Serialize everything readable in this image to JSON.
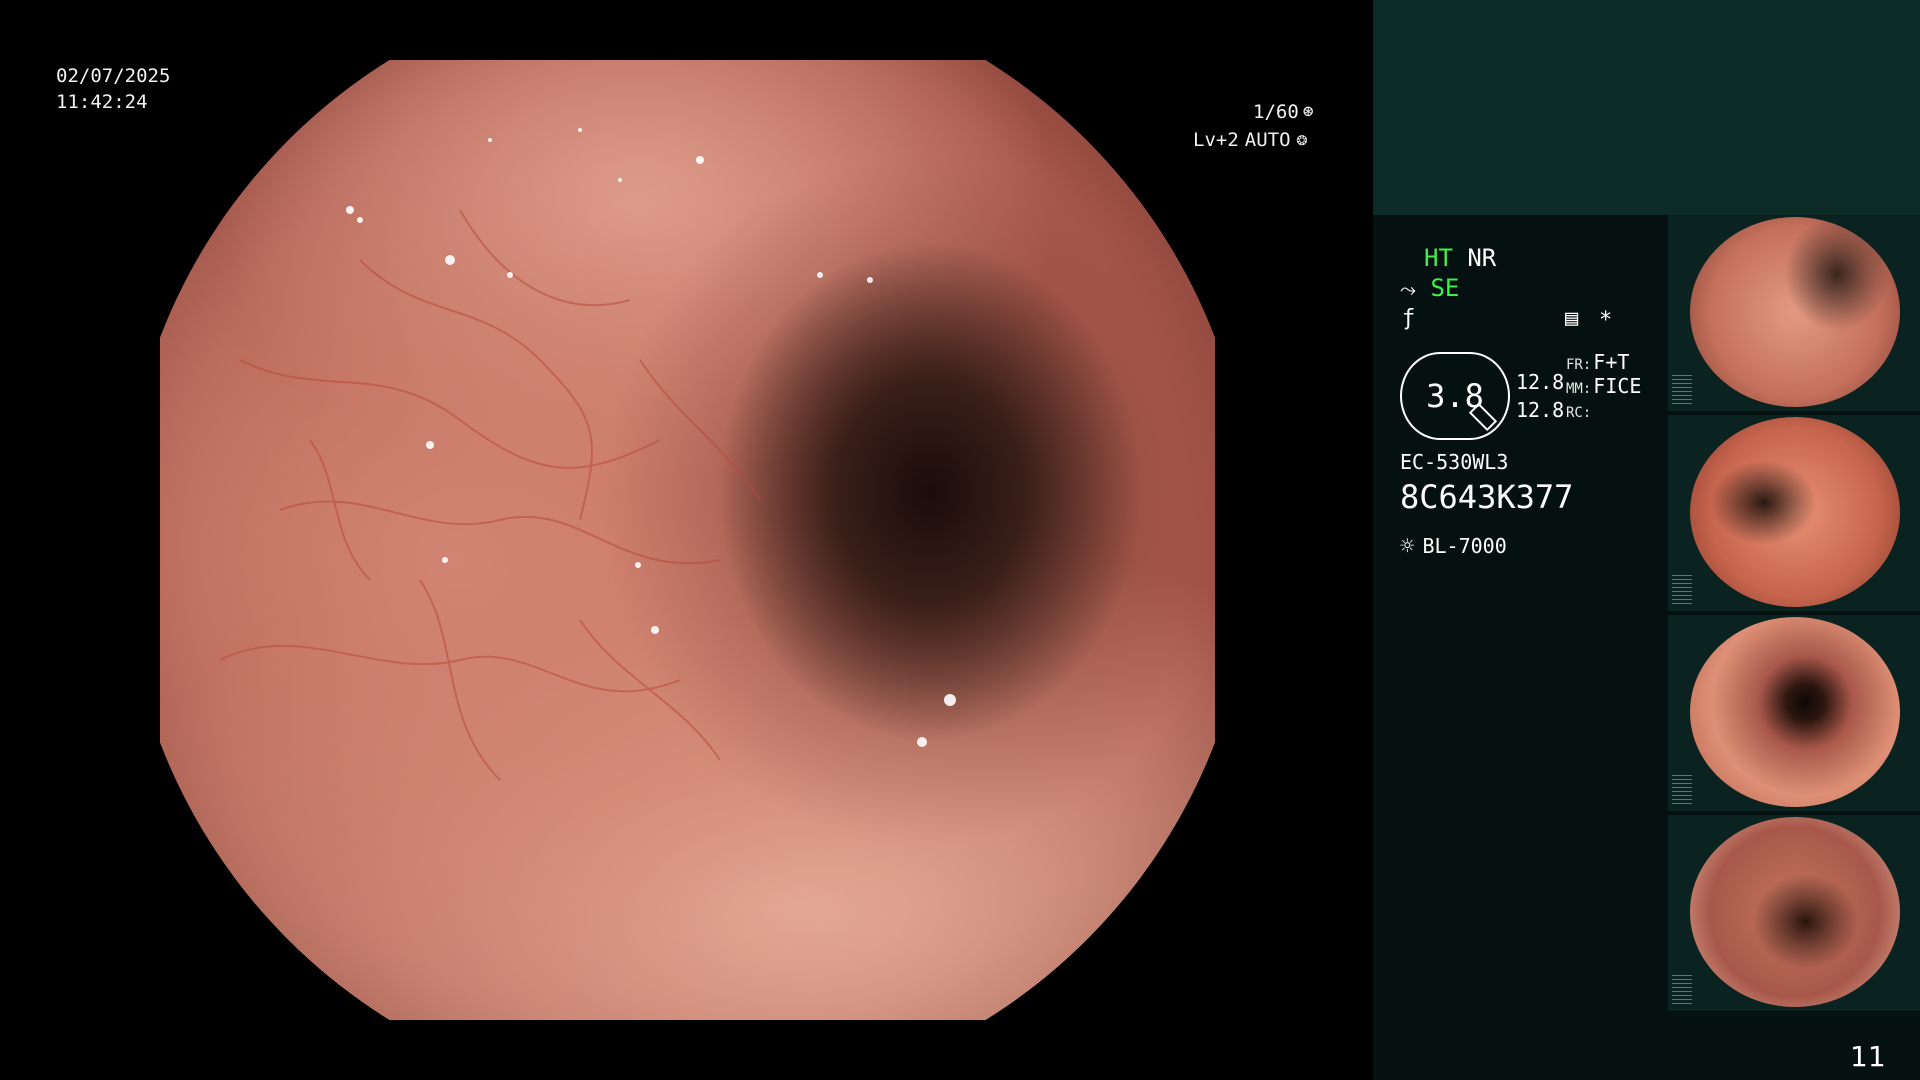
{
  "overlay": {
    "date": "02/07/2025",
    "time": "11:42:24",
    "shutter": "1/60",
    "level": "Lv+2",
    "mode": "AUTO"
  },
  "panel": {
    "ht": "HT",
    "nr": "NR",
    "se": "SE",
    "star": "*",
    "zoom": "3.8",
    "val_a": "12.8",
    "val_b": "12.8",
    "fr_label": "FR:",
    "fr_value": "F+T",
    "mm_label": "MM:",
    "mm_value": "FICE",
    "rc_label": "RC:",
    "scope_model": "EC-530WL3",
    "serial": "8C643K377",
    "light_source": "BL-7000"
  },
  "thumbnails": [
    {
      "label": "thumbnail-1"
    },
    {
      "label": "thumbnail-2"
    },
    {
      "label": "thumbnail-3"
    },
    {
      "label": "thumbnail-4"
    }
  ],
  "page_number": "11",
  "colors": {
    "panel_bg": "#051110",
    "panel_header": "#0d2b27",
    "indicator_green": "#3df04a"
  },
  "icons": [
    "shutter-icon",
    "auto-iris-icon",
    "structure-enhance-icon",
    "color-mode-icon",
    "capture-icon",
    "light-source-icon",
    "magnifier-icon"
  ]
}
